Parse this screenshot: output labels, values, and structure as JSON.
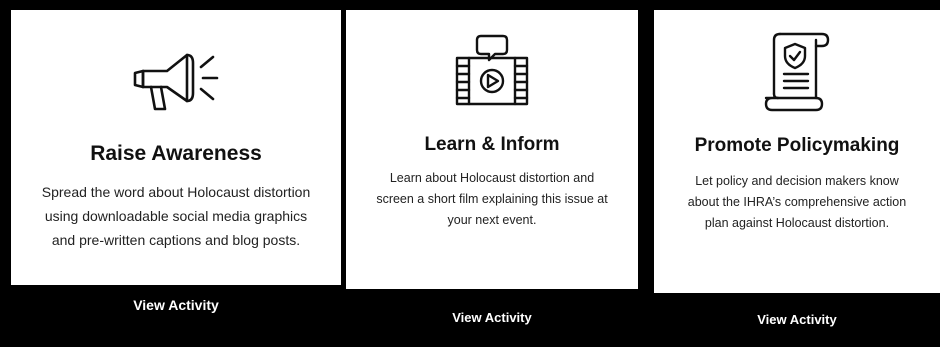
{
  "cards": [
    {
      "title": "Raise Awareness",
      "description_lines": [
        "Spread the word about Holocaust distortion",
        "using downloadable social media graphics",
        "and pre-written captions and blog posts."
      ],
      "button_label": "View Activity",
      "icon": "megaphone-icon"
    },
    {
      "title": "Learn & Inform",
      "description_lines": [
        "Learn about Holocaust distortion and",
        "screen a short film explaining this issue at",
        "your next event."
      ],
      "button_label": "View Activity",
      "icon": "film-video-icon"
    },
    {
      "title": "Promote Policymaking",
      "description_lines": [
        "Let policy and decision makers know",
        "about the IHRA’s comprehensive action",
        "plan against Holocaust distortion."
      ],
      "button_label": "View Activity",
      "icon": "policy-scroll-icon"
    }
  ]
}
